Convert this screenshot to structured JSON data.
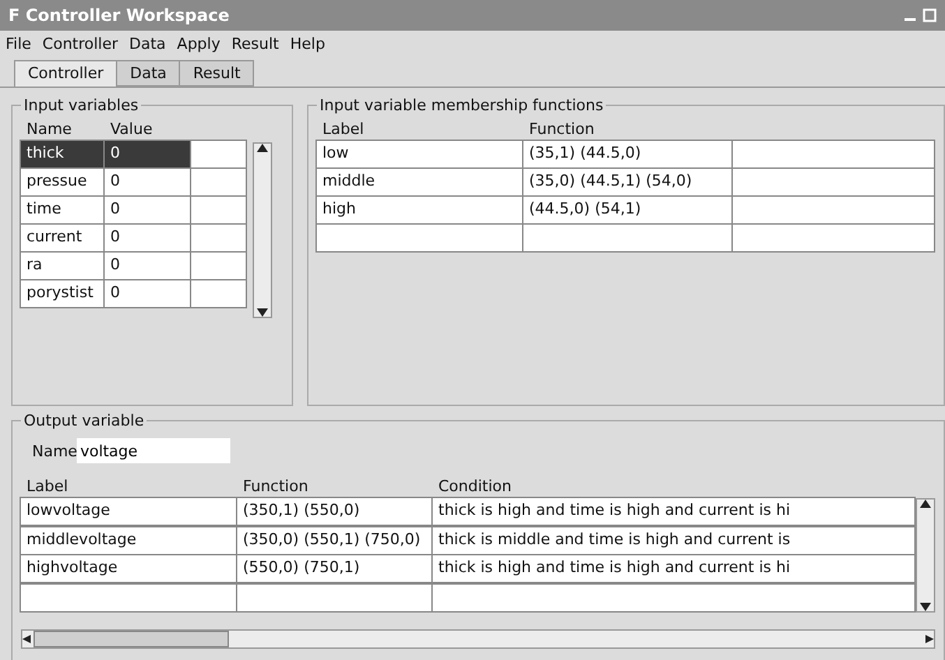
{
  "window": {
    "title": "F Controller Workspace"
  },
  "menu": [
    "File",
    "Controller",
    "Data",
    "Apply",
    "Result",
    "Help"
  ],
  "tabs": [
    {
      "label": "Controller",
      "selected": true
    },
    {
      "label": "Data",
      "selected": false
    },
    {
      "label": "Result",
      "selected": false
    }
  ],
  "input_variables": {
    "title": "Input variables",
    "columns": [
      "Name",
      "Value"
    ],
    "rows": [
      {
        "name": "thick",
        "value": "0",
        "selected": true
      },
      {
        "name": "pressue",
        "value": "0",
        "selected": false
      },
      {
        "name": "time",
        "value": "0",
        "selected": false
      },
      {
        "name": "current",
        "value": "0",
        "selected": false
      },
      {
        "name": "ra",
        "value": "0",
        "selected": false
      },
      {
        "name": "porystist",
        "value": "0",
        "selected": false
      }
    ]
  },
  "membership": {
    "title": "Input variable membership functions",
    "columns": [
      "Label",
      "Function"
    ],
    "rows": [
      {
        "label": "low",
        "function": "(35,1) (44.5,0)"
      },
      {
        "label": "middle",
        "function": "(35,0) (44.5,1) (54,0)"
      },
      {
        "label": "high",
        "function": "(44.5,0) (54,1)"
      }
    ]
  },
  "output_variable": {
    "title": "Output variable",
    "name_label": "Name",
    "name_value": "voltage",
    "columns": [
      "Label",
      "Function",
      "Condition"
    ],
    "rows": [
      {
        "label": "lowvoltage",
        "function": "(350,1) (550,0)",
        "condition": "thick is high and time is high and current is hi"
      },
      {
        "label": "middlevoltage",
        "function": "(350,0) (550,1) (750,0)",
        "condition": "thick is middle and time is high and current is"
      },
      {
        "label": "highvoltage",
        "function": "(550,0) (750,1)",
        "condition": "thick is high and time is high and current is hi"
      }
    ]
  }
}
